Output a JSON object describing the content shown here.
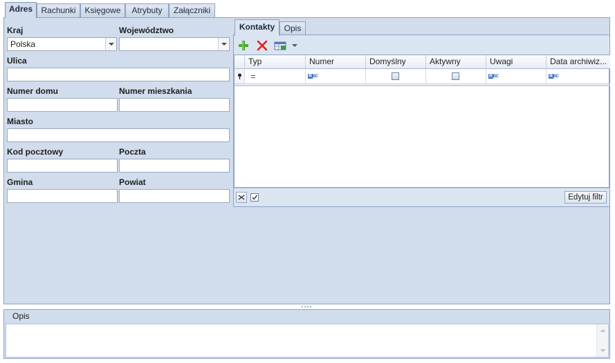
{
  "tabs": [
    "Adres",
    "Rachunki",
    "Księgowe",
    "Atrybuty",
    "Załączniki"
  ],
  "address": {
    "kraj_label": "Kraj",
    "kraj_value": "Polska",
    "wojewodztwo_label": "Województwo",
    "ulica_label": "Ulica",
    "numer_domu_label": "Numer domu",
    "numer_mieszkania_label": "Numer mieszkania",
    "miasto_label": "Miasto",
    "kod_pocztowy_label": "Kod pocztowy",
    "poczta_label": "Poczta",
    "gmina_label": "Gmina",
    "powiat_label": "Powiat"
  },
  "inner_tabs": [
    "Kontakty",
    "Opis"
  ],
  "toolbar": {
    "add_icon": "plus-icon",
    "delete_icon": "x-icon",
    "export_icon": "grid-export-icon"
  },
  "grid": {
    "columns": [
      "Typ",
      "Numer",
      "Domyślny",
      "Aktywny",
      "Uwagi",
      "Data archiwiz..."
    ],
    "filter_row_typ": "="
  },
  "footer": {
    "edit_filter_label": "Edytuj filtr"
  },
  "opis": {
    "label": "Opis"
  },
  "colors": {
    "panel_bg": "#d1dcec",
    "border": "#8ea3c2"
  }
}
